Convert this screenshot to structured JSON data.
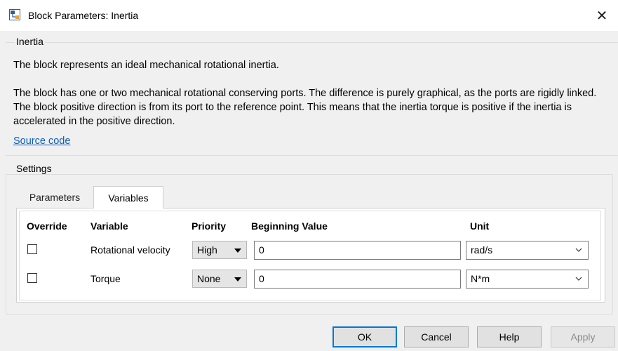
{
  "window": {
    "title": "Block Parameters: Inertia",
    "close_glyph": "✕"
  },
  "description": {
    "group_label": "Inertia",
    "line1": "The block represents an ideal mechanical rotational inertia.",
    "paragraph": "The block has one or two mechanical rotational conserving ports. The difference is purely graphical, as the ports are rigidly linked. The block positive direction is from its port to the reference point. This means that the inertia torque is positive if the inertia is accelerated in the positive direction.",
    "source_link": "Source code"
  },
  "settings": {
    "group_label": "Settings",
    "tabs": [
      {
        "label": "Parameters",
        "active": false
      },
      {
        "label": "Variables",
        "active": true
      }
    ],
    "columns": {
      "override": "Override",
      "variable": "Variable",
      "priority": "Priority",
      "beginning_value": "Beginning Value",
      "unit": "Unit"
    },
    "rows": [
      {
        "override": false,
        "variable": "Rotational velocity",
        "priority": "High",
        "beginning_value": "0",
        "unit": "rad/s"
      },
      {
        "override": false,
        "variable": "Torque",
        "priority": "None",
        "beginning_value": "0",
        "unit": "N*m"
      }
    ]
  },
  "buttons": {
    "ok": "OK",
    "cancel": "Cancel",
    "help": "Help",
    "apply": "Apply"
  },
  "colors": {
    "link": "#0b5bbd",
    "ok_border": "#0078d7",
    "disabled_text": "#8a8a8a"
  }
}
